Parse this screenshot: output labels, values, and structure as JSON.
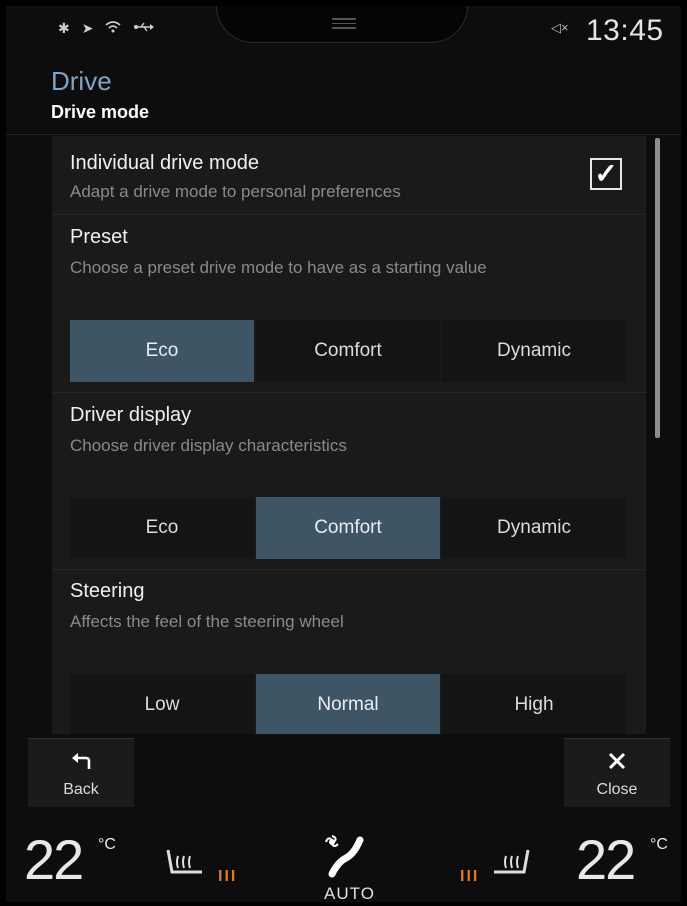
{
  "status": {
    "icons": [
      "bluetooth-icon",
      "location-icon",
      "wifi-icon",
      "usb-icon"
    ],
    "mute_icon": "speaker-mute-icon",
    "time": "13:45"
  },
  "header": {
    "title": "Drive",
    "subtitle": "Drive mode"
  },
  "settings": {
    "individual": {
      "title": "Individual drive mode",
      "description": "Adapt a drive mode to personal preferences",
      "checked": true
    },
    "preset": {
      "title": "Preset",
      "description": "Choose a preset drive mode to have as a starting value",
      "options": [
        "Eco",
        "Comfort",
        "Dynamic"
      ],
      "selected": "Eco"
    },
    "driver_display": {
      "title": "Driver display",
      "description": "Choose driver display characteristics",
      "options": [
        "Eco",
        "Comfort",
        "Dynamic"
      ],
      "selected": "Comfort"
    },
    "steering": {
      "title": "Steering",
      "description": "Affects the feel of the steering wheel",
      "options": [
        "Low",
        "Normal",
        "High"
      ],
      "selected": "Normal"
    }
  },
  "actions": {
    "back_label": "Back",
    "close_label": "Close"
  },
  "climate": {
    "left_temp": "22",
    "right_temp": "22",
    "unit": "°C",
    "left_seat_heat_level": "III",
    "right_seat_heat_level": "III",
    "fan_label": "AUTO"
  },
  "colors": {
    "accent": "#7fa4c4",
    "selected": "#3e5566",
    "heat": "#e07a1e"
  }
}
